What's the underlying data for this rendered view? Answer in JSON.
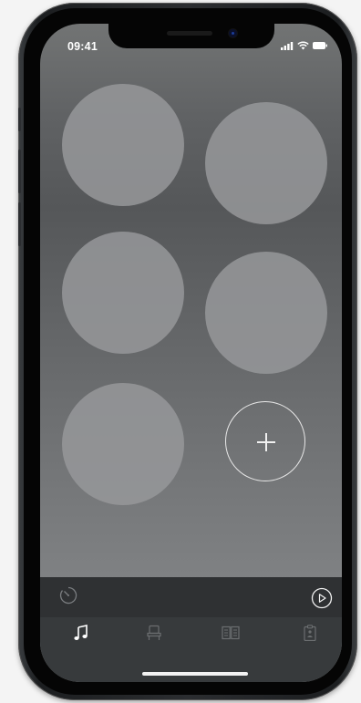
{
  "status_bar": {
    "time": "09:41",
    "icons": [
      "signal-icon",
      "wifi-icon",
      "battery-icon"
    ]
  },
  "circles": [
    {
      "name": "preset-circle-1",
      "position": "row-1-left"
    },
    {
      "name": "preset-circle-2",
      "position": "row-1-right"
    },
    {
      "name": "preset-circle-3",
      "position": "row-2-left"
    },
    {
      "name": "preset-circle-4",
      "position": "row-2-right"
    },
    {
      "name": "preset-circle-5",
      "position": "row-3-left"
    }
  ],
  "add_button": {
    "icon": "plus-icon"
  },
  "player_bar": {
    "left_icon": "timer-icon",
    "right_icon": "play-icon"
  },
  "tab_bar": {
    "tabs": [
      {
        "icon": "music-note-icon",
        "active": true
      },
      {
        "icon": "chair-icon",
        "active": false
      },
      {
        "icon": "book-icon",
        "active": false
      },
      {
        "icon": "clipboard-icon",
        "active": false
      }
    ]
  },
  "colors": {
    "active_icon": "#ffffff",
    "inactive_icon": "#6b6e70",
    "player_bar": "#2f3133",
    "tab_bar": "#373a3c"
  }
}
